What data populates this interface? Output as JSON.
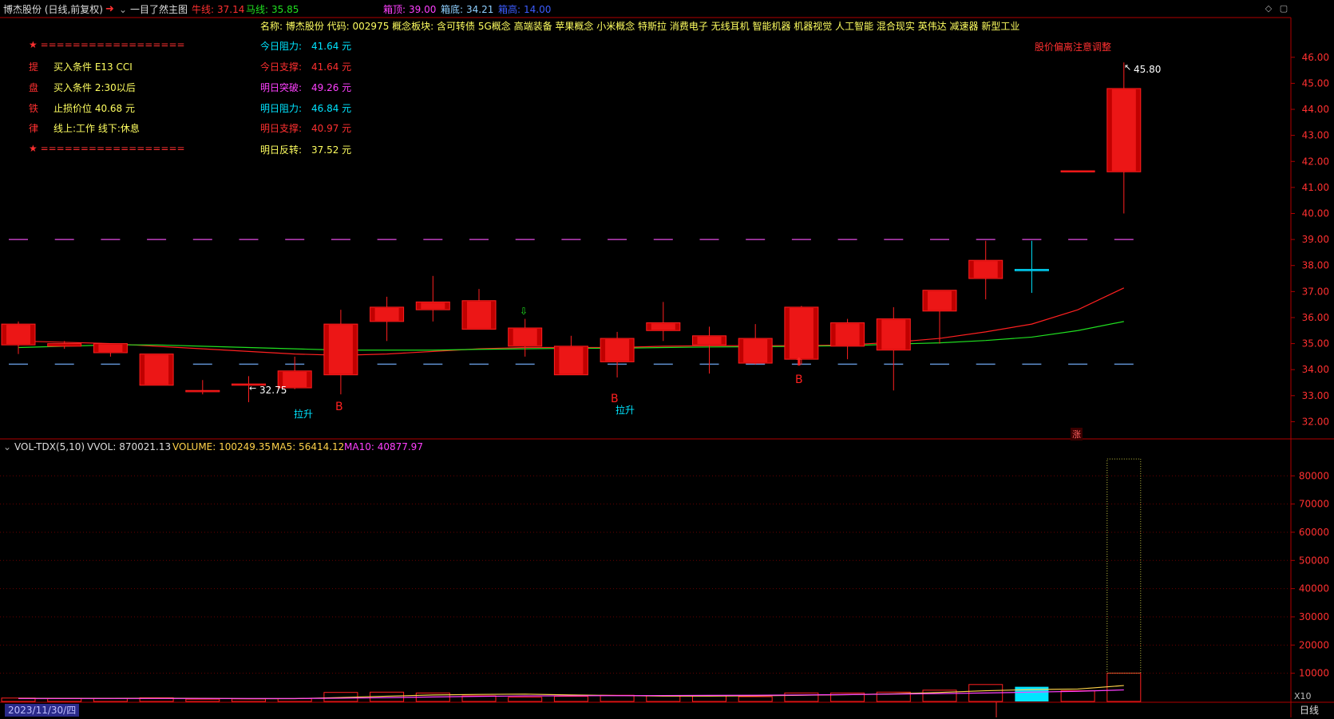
{
  "header": {
    "title": "博杰股份 (日线,前复权)",
    "indicator_name": "一目了然主图",
    "niu_label": "牛线:",
    "niu_value": "37.14",
    "ma_label": "马线:",
    "ma_value": "35.85",
    "box_top_label": "箱顶:",
    "box_top_value": "39.00",
    "box_bottom_label": "箱底:",
    "box_bottom_value": "34.21",
    "box_height_label": "箱高:",
    "box_height_value": "14.00"
  },
  "stock_info": {
    "line": "名称: 博杰股份  代码: 002975  概念板块: 含可转债 5G概念 高端装备 苹果概念 小米概念 特斯拉 消费电子 无线耳机 智能机器 机器视觉 人工智能 混合现实 英伟达 减速器 新型工业"
  },
  "left_panel": {
    "top_border": "★ ==================",
    "bottom_border": "★ ==================",
    "rows": [
      {
        "tag": "提",
        "text": "买入条件 E13 CCI"
      },
      {
        "tag": "盘",
        "text": "买入条件 2:30以后"
      },
      {
        "tag": "铁",
        "text": "止损价位 40.68 元"
      },
      {
        "tag": "律",
        "text": "线上:工作 线下:休息"
      }
    ]
  },
  "levels_panel": {
    "rows": [
      {
        "label": "今日阻力:",
        "value": "41.64 元",
        "color": "#00e5ff"
      },
      {
        "label": "今日支撑:",
        "value": "41.64 元",
        "color": "#ff3030"
      },
      {
        "label": "明日突破:",
        "value": "49.26 元",
        "color": "#ff40ff"
      },
      {
        "label": "明日阻力:",
        "value": "46.84 元",
        "color": "#00e5ff"
      },
      {
        "label": "明日支撑:",
        "value": "40.97 元",
        "color": "#ff3030"
      },
      {
        "label": "明日反转:",
        "value": "37.52 元",
        "color": "#ffff60"
      }
    ]
  },
  "warning_text": "股价偏离注意调整",
  "annotations": {
    "high_label": "45.80",
    "low_label": "32.75",
    "lasheng_1": "拉升",
    "lasheng_2": "拉升",
    "b_1": "B",
    "b_2": "B",
    "b_3": "B",
    "zhang": "涨"
  },
  "volume_header": {
    "name": "VOL-TDX(5,10)",
    "vvol": "VVOL: 870021.13",
    "volume": "VOLUME: 100249.35",
    "ma5": "MA5: 56414.12",
    "ma10": "MA10: 40877.97"
  },
  "volume_axis_unit": "X10",
  "footer": {
    "date": "2023/11/30/四",
    "period_button": "日线"
  },
  "colors": {
    "up": "#ff2020",
    "down": "#00e5ff",
    "axis": "#b00000",
    "ma_red": "#ff2020",
    "ma_green": "#20e020",
    "ma5": "#ffd24a",
    "ma10": "#ff40ff"
  },
  "chart_data": [
    {
      "type": "candlestick",
      "title": "一目了然主图",
      "ylim": [
        31.4,
        46.3
      ],
      "y_ticks": [
        32.0,
        33.0,
        34.0,
        35.0,
        36.0,
        37.0,
        38.0,
        39.0,
        40.0,
        41.0,
        42.0,
        43.0,
        44.0,
        45.0,
        46.0
      ],
      "candles": [
        {
          "o": 34.95,
          "h": 35.85,
          "l": 34.6,
          "c": 35.75
        },
        {
          "o": 34.9,
          "h": 35.1,
          "l": 34.8,
          "c": 35.0
        },
        {
          "o": 34.65,
          "h": 35.0,
          "l": 34.5,
          "c": 35.0
        },
        {
          "o": 33.4,
          "h": 34.6,
          "l": 33.4,
          "c": 34.6
        },
        {
          "o": 33.15,
          "h": 33.6,
          "l": 33.05,
          "c": 33.2
        },
        {
          "o": 33.4,
          "h": 33.75,
          "l": 32.75,
          "c": 33.45
        },
        {
          "o": 33.3,
          "h": 34.5,
          "l": 33.25,
          "c": 33.95
        },
        {
          "o": 33.8,
          "h": 36.3,
          "l": 33.05,
          "c": 35.75
        },
        {
          "o": 35.85,
          "h": 36.8,
          "l": 35.1,
          "c": 36.4
        },
        {
          "o": 36.3,
          "h": 37.6,
          "l": 35.85,
          "c": 36.6
        },
        {
          "o": 35.55,
          "h": 37.1,
          "l": 35.55,
          "c": 36.65
        },
        {
          "o": 34.9,
          "h": 35.95,
          "l": 34.5,
          "c": 35.6
        },
        {
          "o": 33.8,
          "h": 35.3,
          "l": 33.8,
          "c": 34.9
        },
        {
          "o": 34.3,
          "h": 35.45,
          "l": 33.7,
          "c": 35.2
        },
        {
          "o": 35.5,
          "h": 36.6,
          "l": 35.1,
          "c": 35.8
        },
        {
          "o": 34.95,
          "h": 35.65,
          "l": 33.85,
          "c": 35.3
        },
        {
          "o": 34.25,
          "h": 35.75,
          "l": 34.2,
          "c": 35.2
        },
        {
          "o": 34.4,
          "h": 36.45,
          "l": 34.2,
          "c": 36.4
        },
        {
          "o": 34.9,
          "h": 35.95,
          "l": 34.4,
          "c": 35.8
        },
        {
          "o": 34.75,
          "h": 36.4,
          "l": 33.2,
          "c": 35.95
        },
        {
          "o": 36.25,
          "h": 37.05,
          "l": 35.0,
          "c": 37.05
        },
        {
          "o": 37.5,
          "h": 38.95,
          "l": 36.7,
          "c": 38.2
        },
        {
          "o": 37.85,
          "h": 38.95,
          "l": 36.95,
          "c": 37.8
        },
        {
          "o": 41.64,
          "h": 41.64,
          "l": 41.64,
          "c": 41.64
        },
        {
          "o": 41.6,
          "h": 45.8,
          "l": 40.0,
          "c": 44.8
        }
      ],
      "ma_red": [
        35.1,
        35.05,
        35.0,
        34.9,
        34.8,
        34.7,
        34.6,
        34.55,
        34.6,
        34.7,
        34.8,
        34.85,
        34.85,
        34.85,
        34.9,
        34.92,
        34.92,
        34.92,
        34.95,
        35.05,
        35.2,
        35.45,
        35.75,
        36.3,
        37.14
      ],
      "ma_green": [
        34.85,
        34.9,
        34.95,
        34.95,
        34.9,
        34.85,
        34.8,
        34.75,
        34.75,
        34.75,
        34.78,
        34.8,
        34.82,
        34.82,
        34.85,
        34.87,
        34.88,
        34.9,
        34.92,
        34.98,
        35.03,
        35.12,
        35.25,
        35.5,
        35.85
      ]
    },
    {
      "type": "bar",
      "title": "VOL-TDX(5,10)",
      "ylim": [
        0,
        88000
      ],
      "y_ticks": [
        10000,
        20000,
        30000,
        40000,
        50000,
        60000,
        70000,
        80000
      ],
      "values": [
        1200,
        1000,
        1100,
        1300,
        800,
        900,
        1000,
        3200,
        3300,
        3000,
        2000,
        1500,
        1800,
        2200,
        2000,
        2100,
        1700,
        3000,
        3000,
        3300,
        4000,
        6000,
        5200,
        3800,
        10030
      ],
      "ma5": [
        1100,
        1100,
        1100,
        1150,
        1100,
        1000,
        1000,
        1400,
        1850,
        2300,
        2500,
        2600,
        2300,
        2100,
        1900,
        1900,
        2000,
        2200,
        2400,
        2700,
        3200,
        3800,
        4200,
        4400,
        5641
      ],
      "ma10": [
        1050,
        1050,
        1050,
        1050,
        1050,
        1050,
        1050,
        1150,
        1350,
        1600,
        1800,
        1950,
        2000,
        2050,
        2100,
        2150,
        2200,
        2300,
        2450,
        2600,
        2800,
        3000,
        3300,
        3600,
        4088
      ]
    }
  ]
}
